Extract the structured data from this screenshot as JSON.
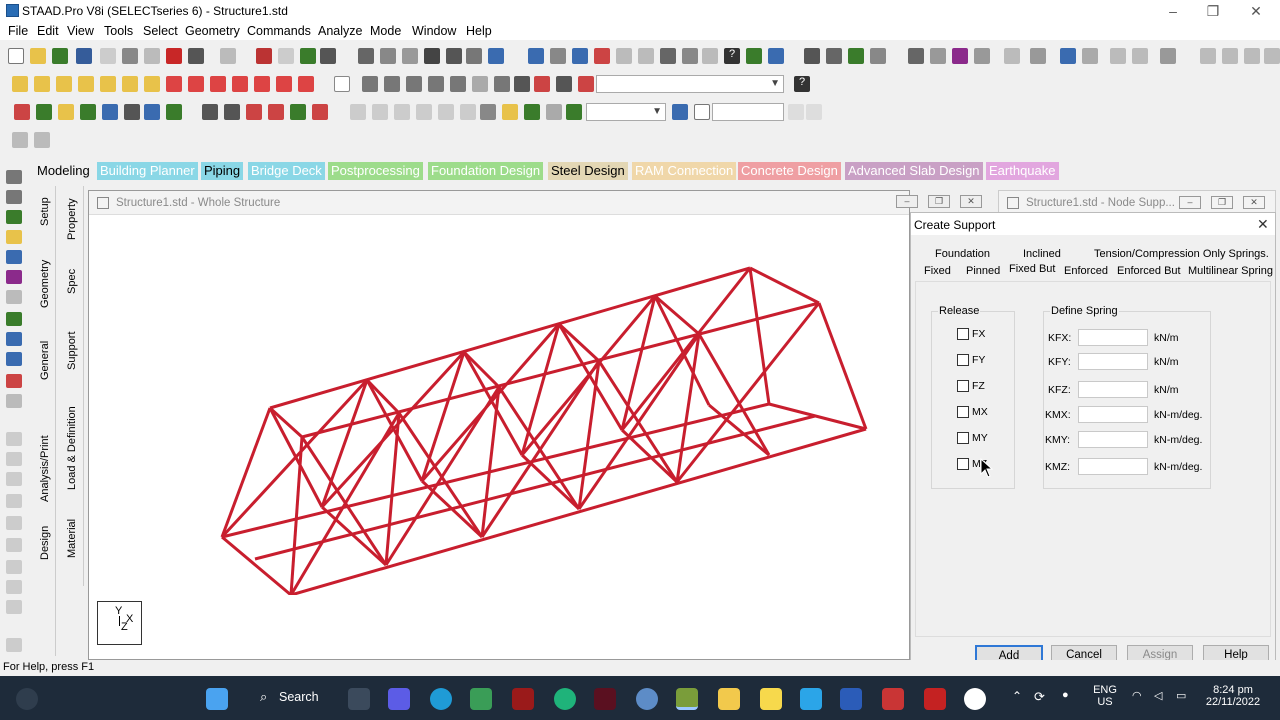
{
  "app": {
    "title": "STAAD.Pro V8i (SELECTseries 6) - Structure1.std"
  },
  "menu": [
    "File",
    "Edit",
    "View",
    "Tools",
    "Select",
    "Geometry",
    "Commands",
    "Analyze",
    "Mode",
    "Window",
    "Help"
  ],
  "page_control": {
    "tabs": [
      "Modeling",
      "Building Planner",
      "Piping",
      "Bridge Deck",
      "Postprocessing",
      "Foundation Design",
      "Steel Design",
      "RAM Connection",
      "Concrete Design",
      "Advanced Slab Design",
      "Earthquake"
    ],
    "active": "Modeling"
  },
  "side_tabs": {
    "outer": [
      "Setup",
      "Geometry",
      "General",
      "Analysis/Print",
      "Design"
    ],
    "inner": [
      "Property",
      "Spec",
      "Support",
      "Load & Definition",
      "Material"
    ]
  },
  "view_window": {
    "title": "Structure1.std - Whole Structure",
    "axes": {
      "y": "Y",
      "x": "X",
      "z": "Z"
    }
  },
  "node_window": {
    "title": "Structure1.std - Node Supp..."
  },
  "dialog": {
    "title": "Create Support",
    "tabs_row1": [
      "Foundation",
      "Inclined",
      "Tension/Compression Only Springs."
    ],
    "tabs_row2": [
      "Fixed",
      "Pinned",
      "Fixed But",
      "Enforced",
      "Enforced But",
      "Multilinear Spring"
    ],
    "active_tab": "Fixed But",
    "release": {
      "label": "Release",
      "items": [
        "FX",
        "FY",
        "FZ",
        "MX",
        "MY",
        "MZ"
      ]
    },
    "spring": {
      "label": "Define Spring",
      "rows": [
        {
          "name": "KFX:",
          "unit": "kN/m",
          "value": ""
        },
        {
          "name": "KFY:",
          "unit": "kN/m",
          "value": ""
        },
        {
          "name": "KFZ:",
          "unit": "kN/m",
          "value": ""
        },
        {
          "name": "KMX:",
          "unit": "kN-m/deg.",
          "value": ""
        },
        {
          "name": "KMY:",
          "unit": "kN-m/deg.",
          "value": ""
        },
        {
          "name": "KMZ:",
          "unit": "kN-m/deg.",
          "value": ""
        }
      ]
    },
    "buttons": {
      "add": "Add",
      "cancel": "Cancel",
      "assign": "Assign",
      "help": "Help"
    }
  },
  "status": "For Help, press F1",
  "taskbar": {
    "search": "Search",
    "lang": "ENG",
    "region": "US",
    "time": "8:24 pm",
    "date": "22/11/2022"
  }
}
